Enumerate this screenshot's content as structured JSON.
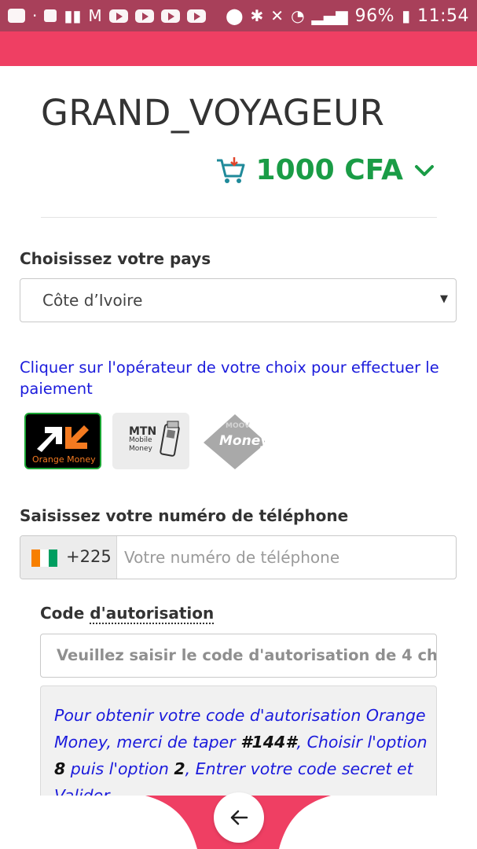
{
  "status_bar": {
    "battery": "96%",
    "time": "11:54"
  },
  "header": {
    "title": "GRAND_VOYAGEUR",
    "cart_amount": "1000 CFA"
  },
  "country": {
    "label": "Choisissez votre pays",
    "selected": "Côte d’Ivoire"
  },
  "operators": {
    "instruction": "Cliquer sur l'opérateur de votre choix pour effectuer le paiement",
    "items": [
      {
        "name": "Orange Money"
      },
      {
        "name": "MTN Mobile Money"
      },
      {
        "name": "MOOV Money"
      }
    ],
    "mtn_lines": [
      "MTN",
      "Mobile",
      "Money"
    ],
    "moov_lines": [
      "MOOV",
      "Money"
    ]
  },
  "phone": {
    "label": "Saisissez votre numéro de téléphone",
    "dial_code": "+225",
    "placeholder": "Votre numéro de téléphone"
  },
  "auth_code": {
    "label_prefix": "Code ",
    "label_dotted": "d'autorisation",
    "placeholder": "Veuillez saisir le code d'autorisation de 4 ch"
  },
  "info": {
    "part1": "Pour obtenir votre code d'autorisation Orange Money, merci de taper ",
    "code": "#144#",
    "part2": ", Choisir l'option ",
    "opt1": "8",
    "part3": " puis l'option ",
    "opt2": "2",
    "part4": ", Entrer votre code secret et Valider."
  },
  "colors": {
    "status_bar": "#a8405a",
    "app_bar": "#ef3f63",
    "accent_green": "#1a9c46",
    "link_blue": "#1b1bdc"
  },
  "icons": {
    "cart": "shopping-cart-icon",
    "chevron": "chevron-down-icon",
    "back": "arrow-left-icon"
  }
}
